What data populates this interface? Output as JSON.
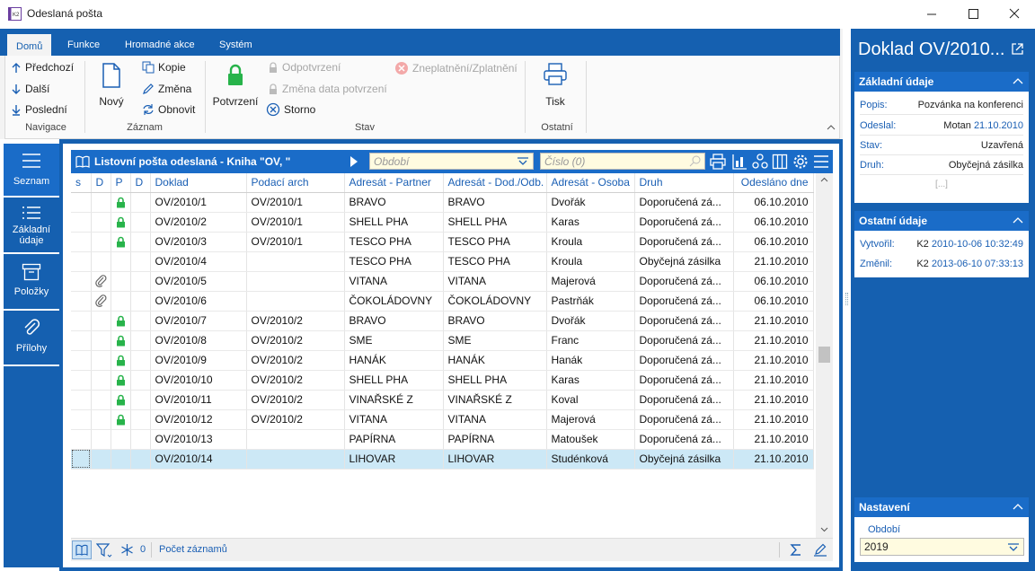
{
  "window": {
    "title": "Odeslaná pošta"
  },
  "ribbon": {
    "tabs": [
      "Domů",
      "Funkce",
      "Hromadné akce",
      "Systém"
    ],
    "navigace": {
      "label": "Navigace",
      "prev": "Předchozí",
      "next": "Další",
      "last": "Poslední"
    },
    "zaznam": {
      "label": "Záznam",
      "new": "Nový",
      "copy": "Kopie",
      "change": "Změna",
      "refresh": "Obnovit"
    },
    "stav": {
      "label": "Stav",
      "confirm": "Potvrzení",
      "unconfirm": "Odpotvrzení",
      "change_date": "Změna data potvrzení",
      "cancel": "Storno",
      "invalidate": "Zneplatnění/Zplatnění"
    },
    "ostatni": {
      "label": "Ostatní",
      "print": "Tisk"
    }
  },
  "leftnav": {
    "items": [
      "Seznam",
      "Základní údaje",
      "Položky",
      "Přílohy"
    ]
  },
  "grid": {
    "title": "Listovní pošta odeslaná - Kniha \"OV, \"",
    "period_placeholder": "Období",
    "number_placeholder": "Číslo (0)",
    "columns": [
      "s",
      "D",
      "P",
      "D",
      "Doklad",
      "Podací arch",
      "Adresát - Partner",
      "Adresát - Dod./Odb.",
      "Adresát - Osoba",
      "Druh",
      "Odesláno dne"
    ],
    "rows": [
      {
        "attach": false,
        "lock": true,
        "doklad": "OV/2010/1",
        "arch": "OV/2010/1",
        "partner": "BRAVO",
        "dod": "BRAVO",
        "osoba": "Dvořák",
        "druh": "Doporučená zá...",
        "date": "06.10.2010"
      },
      {
        "attach": false,
        "lock": true,
        "doklad": "OV/2010/2",
        "arch": "OV/2010/1",
        "partner": "SHELL PHA",
        "dod": "SHELL PHA",
        "osoba": "Karas",
        "druh": "Doporučená zá...",
        "date": "06.10.2010"
      },
      {
        "attach": false,
        "lock": true,
        "doklad": "OV/2010/3",
        "arch": "OV/2010/1",
        "partner": "TESCO PHA",
        "dod": "TESCO PHA",
        "osoba": "Kroula",
        "druh": "Doporučená zá...",
        "date": "06.10.2010"
      },
      {
        "attach": false,
        "lock": false,
        "doklad": "OV/2010/4",
        "arch": "",
        "partner": "TESCO PHA",
        "dod": "TESCO PHA",
        "osoba": "Kroula",
        "druh": "Obyčejná zásilka",
        "date": "21.10.2010"
      },
      {
        "attach": true,
        "lock": false,
        "doklad": "OV/2010/5",
        "arch": "",
        "partner": "VITANA",
        "dod": "VITANA",
        "osoba": "Majerová",
        "druh": "Doporučená zá...",
        "date": "06.10.2010"
      },
      {
        "attach": true,
        "lock": false,
        "doklad": "OV/2010/6",
        "arch": "",
        "partner": "ČOKOLÁDOVNY",
        "dod": "ČOKOLÁDOVNY",
        "osoba": "Pastrňák",
        "druh": "Doporučená zá...",
        "date": "06.10.2010"
      },
      {
        "attach": false,
        "lock": true,
        "doklad": "OV/2010/7",
        "arch": "OV/2010/2",
        "partner": "BRAVO",
        "dod": "BRAVO",
        "osoba": "Dvořák",
        "druh": "Doporučená zá...",
        "date": "21.10.2010"
      },
      {
        "attach": false,
        "lock": true,
        "doklad": "OV/2010/8",
        "arch": "OV/2010/2",
        "partner": "SME",
        "dod": "SME",
        "osoba": "Franc",
        "druh": "Doporučená zá...",
        "date": "21.10.2010"
      },
      {
        "attach": false,
        "lock": true,
        "doklad": "OV/2010/9",
        "arch": "OV/2010/2",
        "partner": "HANÁK",
        "dod": "HANÁK",
        "osoba": "Hanák",
        "druh": "Doporučená zá...",
        "date": "21.10.2010"
      },
      {
        "attach": false,
        "lock": true,
        "doklad": "OV/2010/10",
        "arch": "OV/2010/2",
        "partner": "SHELL PHA",
        "dod": "SHELL PHA",
        "osoba": "Karas",
        "druh": "Doporučená zá...",
        "date": "21.10.2010"
      },
      {
        "attach": false,
        "lock": true,
        "doklad": "OV/2010/11",
        "arch": "OV/2010/2",
        "partner": "VINAŘSKÉ Z",
        "dod": "VINAŘSKÉ Z",
        "osoba": "Koval",
        "druh": "Doporučená zá...",
        "date": "21.10.2010"
      },
      {
        "attach": false,
        "lock": true,
        "doklad": "OV/2010/12",
        "arch": "OV/2010/2",
        "partner": "VITANA",
        "dod": "VITANA",
        "osoba": "Majerová",
        "druh": "Doporučená zá...",
        "date": "21.10.2010"
      },
      {
        "attach": false,
        "lock": false,
        "doklad": "OV/2010/13",
        "arch": "",
        "partner": "PAPÍRNA",
        "dod": "PAPÍRNA",
        "osoba": "Matoušek",
        "druh": "Doporučená zá...",
        "date": "21.10.2010"
      },
      {
        "attach": false,
        "lock": false,
        "doklad": "OV/2010/14",
        "arch": "",
        "partner": "LIHOVAR",
        "dod": "LIHOVAR",
        "osoba": "Studénková",
        "druh": "Obyčejná zásilka",
        "date": "21.10.2010",
        "selected": true
      }
    ]
  },
  "statusbar": {
    "count": "0",
    "records_label": "Počet záznamů"
  },
  "rightpane": {
    "title": "Doklad OV/2010...",
    "basic": {
      "header": "Základní údaje",
      "popis_k": "Popis:",
      "popis_v": "Pozvánka na konferenci",
      "odeslal_k": "Odeslal:",
      "odeslal_v": "Motan",
      "odeslal_date": "21.10.2010",
      "stav_k": "Stav:",
      "stav_v": "Uzavřená",
      "druh_k": "Druh:",
      "druh_v": "Obyčejná zásilka",
      "more": "[...]"
    },
    "other": {
      "header": "Ostatní údaje",
      "created_k": "Vytvořil:",
      "created_user": "K2",
      "created_v": "2010-10-06 10:32:49",
      "changed_k": "Změnil:",
      "changed_user": "K2",
      "changed_v": "2013-06-10 07:33:13"
    },
    "settings": {
      "header": "Nastavení",
      "period_label": "Období",
      "period_value": "2019"
    }
  },
  "colors": {
    "accent": "#1560b0",
    "header": "#1a6cc8",
    "lock": "#27b34a",
    "selected": "#cce8f6"
  },
  "icons": [
    "app-icon",
    "minimize-icon",
    "maximize-icon",
    "close-icon",
    "arrow-up-icon",
    "arrow-down-icon",
    "arrow-bottom-icon",
    "new-document-icon",
    "copy-icon",
    "pencil-icon",
    "refresh-icon",
    "lock-icon",
    "cancel-icon",
    "invalid-icon",
    "printer-icon",
    "list-icon",
    "lines-icon",
    "box-icon",
    "paperclip-icon",
    "book-icon",
    "filter-icon",
    "snowflake-icon",
    "sigma-icon",
    "gear-icon",
    "menu-icon",
    "popout-icon",
    "chevron-up-icon"
  ]
}
